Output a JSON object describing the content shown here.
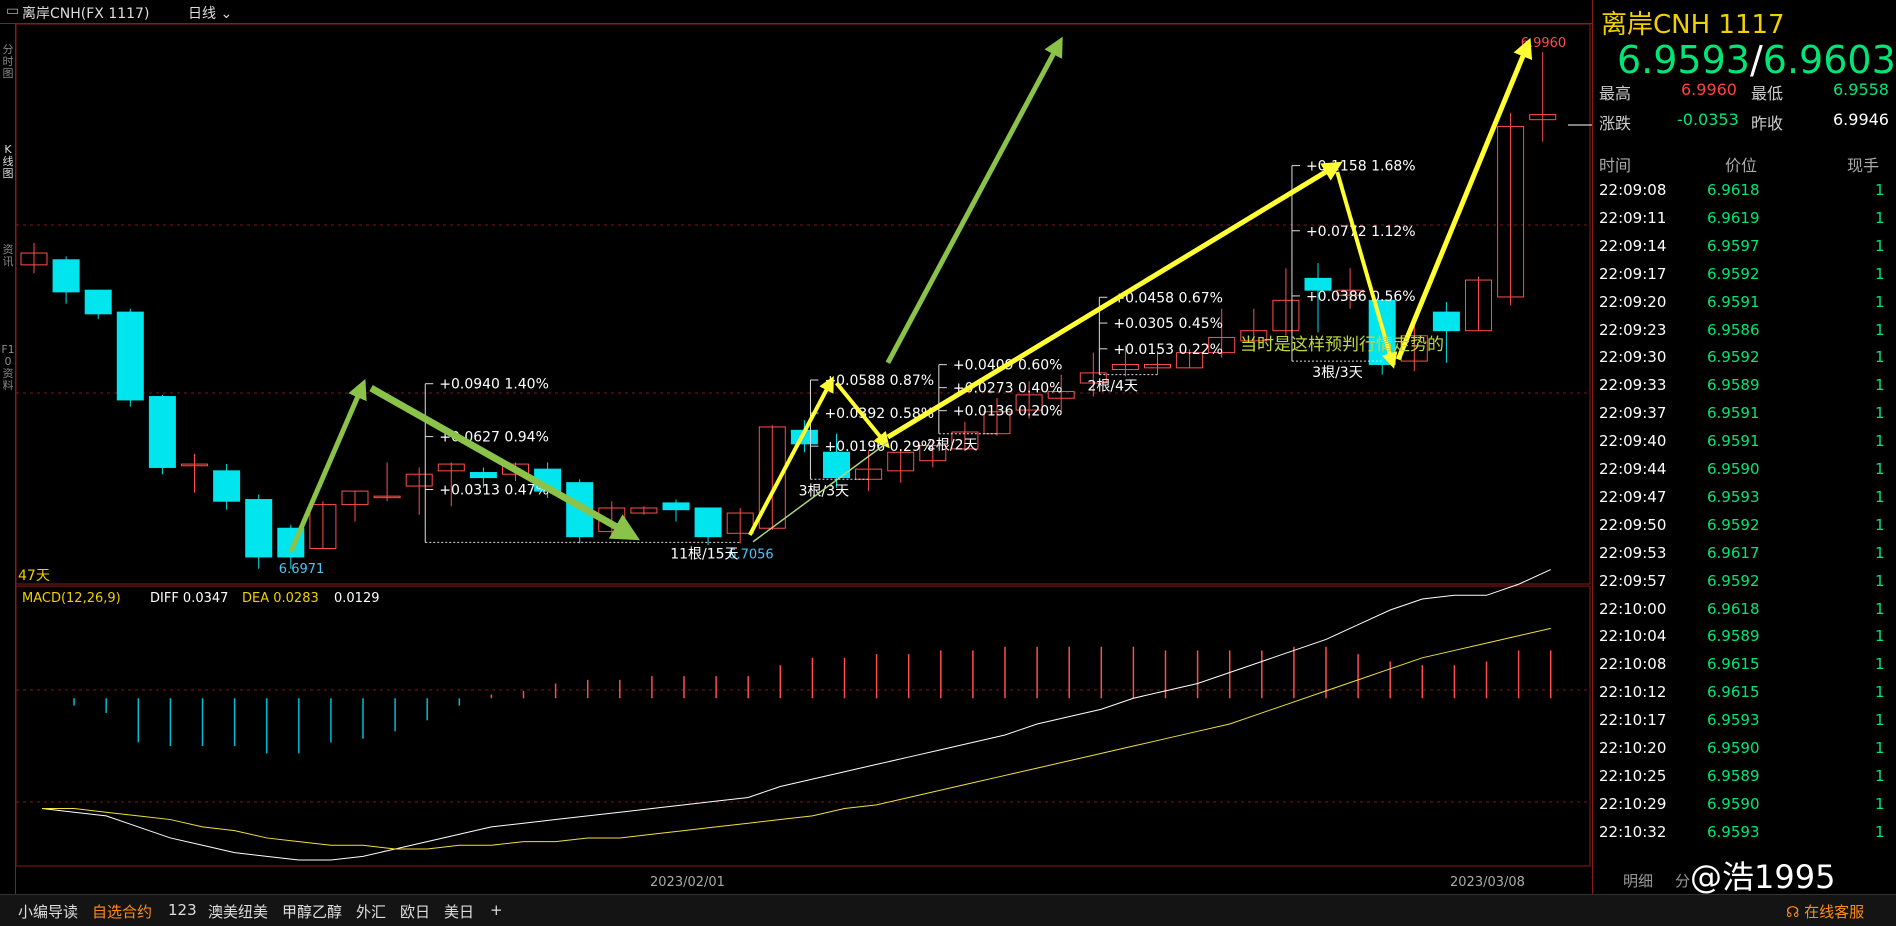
{
  "topbar": {
    "symbol": "离岸CNH(FX 1117)",
    "period": "日线"
  },
  "leftstrip": [
    "分时图",
    "K线图",
    "资讯",
    "F10资料"
  ],
  "chart_data": {
    "type": "candlestick",
    "ylim": [
      6.694,
      7.002
    ],
    "price_lines": [
      {
        "label": "6.6971",
        "value": 6.6971
      },
      {
        "label": "6.7056",
        "value": 6.7056
      },
      {
        "label": "6.9960",
        "value": 6.996
      }
    ],
    "candles": [
      [
        6.87,
        6.877,
        6.865,
        6.883
      ],
      [
        6.873,
        6.854,
        6.847,
        6.875
      ],
      [
        6.855,
        6.841,
        6.838,
        6.855
      ],
      [
        6.842,
        6.79,
        6.786,
        6.844
      ],
      [
        6.792,
        6.75,
        6.746,
        6.793
      ],
      [
        6.751,
        6.752,
        6.735,
        6.758
      ],
      [
        6.748,
        6.73,
        6.725,
        6.752
      ],
      [
        6.731,
        6.697,
        6.69,
        6.734
      ],
      [
        6.714,
        6.697,
        6.69,
        6.716
      ],
      [
        6.702,
        6.728,
        6.702,
        6.73
      ],
      [
        6.728,
        6.736,
        6.718,
        6.736
      ],
      [
        6.733,
        6.733,
        6.73,
        6.753
      ],
      [
        6.739,
        6.746,
        6.722,
        6.75
      ],
      [
        6.748,
        6.752,
        6.727,
        6.753
      ],
      [
        6.747,
        6.744,
        6.738,
        6.75
      ],
      [
        6.746,
        6.752,
        6.742,
        6.753
      ],
      [
        6.749,
        6.736,
        6.732,
        6.753
      ],
      [
        6.741,
        6.709,
        6.705,
        6.743
      ],
      [
        6.712,
        6.726,
        6.709,
        6.73
      ],
      [
        6.723,
        6.726,
        6.722,
        6.727
      ],
      [
        6.729,
        6.725,
        6.718,
        6.731
      ],
      [
        6.726,
        6.709,
        6.704,
        6.726
      ],
      [
        6.711,
        6.723,
        6.705,
        6.726
      ],
      [
        6.714,
        6.774,
        6.713,
        6.775
      ],
      [
        6.772,
        6.764,
        6.759,
        6.778
      ],
      [
        6.759,
        6.744,
        6.738,
        6.77
      ],
      [
        6.743,
        6.749,
        6.736,
        6.76
      ],
      [
        6.748,
        6.759,
        6.741,
        6.761
      ],
      [
        6.754,
        6.763,
        6.75,
        6.766
      ],
      [
        6.761,
        6.771,
        6.76,
        6.777
      ],
      [
        6.77,
        6.783,
        6.769,
        6.791
      ],
      [
        6.784,
        6.793,
        6.779,
        6.801
      ],
      [
        6.791,
        6.795,
        6.783,
        6.805
      ],
      [
        6.8,
        6.806,
        6.792,
        6.818
      ],
      [
        6.808,
        6.811,
        6.804,
        6.822
      ],
      [
        6.809,
        6.811,
        6.805,
        6.819
      ],
      [
        6.809,
        6.818,
        6.809,
        6.82
      ],
      [
        6.818,
        6.827,
        6.815,
        6.844
      ],
      [
        6.825,
        6.831,
        6.819,
        6.844
      ],
      [
        6.831,
        6.849,
        6.828,
        6.868
      ],
      [
        6.862,
        6.855,
        6.83,
        6.871
      ],
      [
        6.852,
        6.855,
        6.844,
        6.868
      ],
      [
        6.849,
        6.811,
        6.805,
        6.849
      ],
      [
        6.813,
        6.828,
        6.807,
        6.835
      ],
      [
        6.842,
        6.831,
        6.812,
        6.848
      ],
      [
        6.831,
        6.861,
        6.831,
        6.863
      ],
      [
        6.851,
        6.952,
        6.846,
        6.96
      ],
      [
        6.956,
        6.959,
        6.943,
        6.996
      ]
    ],
    "measures": [
      {
        "label": "+0.0940  1.40%"
      },
      {
        "label": "+0.0627  0.94%"
      },
      {
        "label": "+0.0313  0.47%"
      },
      {
        "label": "11根/15天"
      },
      {
        "label": "+0.0588  0.87%"
      },
      {
        "label": "+0.0392  0.58%"
      },
      {
        "label": "+0.0196  0.29%"
      },
      {
        "label": "3根/3天"
      },
      {
        "label": "+0.0409  0.60%"
      },
      {
        "label": "+0.0273  0.40%"
      },
      {
        "label": "+0.0136  0.20%"
      },
      {
        "label": "2根/2天"
      },
      {
        "label": "+0.0458  0.67%"
      },
      {
        "label": "+0.0305  0.45%"
      },
      {
        "label": "+0.0153  0.22%"
      },
      {
        "label": "2根/4天"
      },
      {
        "label": "+0.1158  1.68%"
      },
      {
        "label": "+0.0772  1.12%"
      },
      {
        "label": "+0.0386  0.56%"
      },
      {
        "label": "3根/3天"
      }
    ],
    "annotation": "当时是这样预判行情走势的",
    "days_label": "47天",
    "x_labels": [
      "2023/02/01",
      "2023/03/08"
    ],
    "macd": {
      "label": "MACD(12,26,9)",
      "diff_label": "DIFF 0.0347",
      "dea_label": "DEA 0.0283",
      "macd_value": "0.0129",
      "ylim": [
        -0.044,
        0.024
      ],
      "hist": [
        0.0,
        -0.002,
        -0.004,
        -0.012,
        -0.013,
        -0.013,
        -0.013,
        -0.015,
        -0.015,
        -0.012,
        -0.011,
        -0.009,
        -0.006,
        -0.002,
        0.001,
        0.002,
        0.004,
        0.005,
        0.005,
        0.006,
        0.006,
        0.006,
        0.006,
        0.009,
        0.011,
        0.011,
        0.012,
        0.012,
        0.013,
        0.013,
        0.014,
        0.014,
        0.014,
        0.014,
        0.014,
        0.013,
        0.013,
        0.013,
        0.013,
        0.014,
        0.014,
        0.012,
        0.01,
        0.009,
        0.009,
        0.01,
        0.013,
        0.013
      ],
      "diff": [
        -0.03,
        -0.031,
        -0.032,
        -0.035,
        -0.038,
        -0.04,
        -0.042,
        -0.043,
        -0.044,
        -0.044,
        -0.043,
        -0.041,
        -0.039,
        -0.037,
        -0.035,
        -0.034,
        -0.033,
        -0.032,
        -0.031,
        -0.03,
        -0.029,
        -0.028,
        -0.027,
        -0.024,
        -0.022,
        -0.02,
        -0.018,
        -0.016,
        -0.014,
        -0.012,
        -0.01,
        -0.007,
        -0.005,
        -0.003,
        0.0,
        0.002,
        0.004,
        0.007,
        0.01,
        0.013,
        0.016,
        0.02,
        0.024,
        0.027,
        0.028,
        0.028,
        0.031,
        0.035
      ],
      "dea": [
        -0.03,
        -0.03,
        -0.031,
        -0.032,
        -0.033,
        -0.035,
        -0.036,
        -0.038,
        -0.039,
        -0.04,
        -0.04,
        -0.041,
        -0.041,
        -0.04,
        -0.04,
        -0.039,
        -0.039,
        -0.038,
        -0.038,
        -0.037,
        -0.036,
        -0.035,
        -0.034,
        -0.033,
        -0.032,
        -0.03,
        -0.029,
        -0.027,
        -0.025,
        -0.023,
        -0.021,
        -0.019,
        -0.017,
        -0.015,
        -0.013,
        -0.011,
        -0.009,
        -0.007,
        -0.004,
        -0.001,
        0.002,
        0.005,
        0.008,
        0.011,
        0.013,
        0.015,
        0.017,
        0.019
      ]
    }
  },
  "rpanel": {
    "title": "离岸CNH  1117",
    "price_left": "6.9593",
    "price_sep": "/",
    "price_right": "6.9603",
    "high_label": "最高",
    "high": "6.9960",
    "low_label": "最低",
    "low": "6.9558",
    "chg_label": "涨跌",
    "chg": "-0.0353",
    "prev_label": "昨收",
    "prev": "6.9946",
    "cols": [
      "时间",
      "价位",
      "现手"
    ],
    "ticks": [
      [
        "22:09:08",
        "6.9618",
        "1"
      ],
      [
        "22:09:11",
        "6.9619",
        "1"
      ],
      [
        "22:09:14",
        "6.9597",
        "1"
      ],
      [
        "22:09:17",
        "6.9592",
        "1"
      ],
      [
        "22:09:20",
        "6.9591",
        "1"
      ],
      [
        "22:09:23",
        "6.9586",
        "1"
      ],
      [
        "22:09:30",
        "6.9592",
        "1"
      ],
      [
        "22:09:33",
        "6.9589",
        "1"
      ],
      [
        "22:09:37",
        "6.9591",
        "1"
      ],
      [
        "22:09:40",
        "6.9591",
        "1"
      ],
      [
        "22:09:44",
        "6.9590",
        "1"
      ],
      [
        "22:09:47",
        "6.9593",
        "1"
      ],
      [
        "22:09:50",
        "6.9592",
        "1"
      ],
      [
        "22:09:53",
        "6.9617",
        "1"
      ],
      [
        "22:09:57",
        "6.9592",
        "1"
      ],
      [
        "22:10:00",
        "6.9618",
        "1"
      ],
      [
        "22:10:04",
        "6.9589",
        "1"
      ],
      [
        "22:10:08",
        "6.9615",
        "1"
      ],
      [
        "22:10:12",
        "6.9615",
        "1"
      ],
      [
        "22:10:17",
        "6.9593",
        "1"
      ],
      [
        "22:10:20",
        "6.9590",
        "1"
      ],
      [
        "22:10:25",
        "6.9589",
        "1"
      ],
      [
        "22:10:29",
        "6.9590",
        "1"
      ],
      [
        "22:10:32",
        "6.9593",
        "1"
      ]
    ],
    "tabs": [
      "明细",
      "分"
    ]
  },
  "bottombar": {
    "tabs": [
      "小编导读",
      "自选合约",
      "123",
      "澳美纽美",
      "甲醇乙醇",
      "外汇",
      "欧日",
      "美日",
      "+"
    ],
    "service": "在线客服"
  },
  "watermark": "@浩1995"
}
